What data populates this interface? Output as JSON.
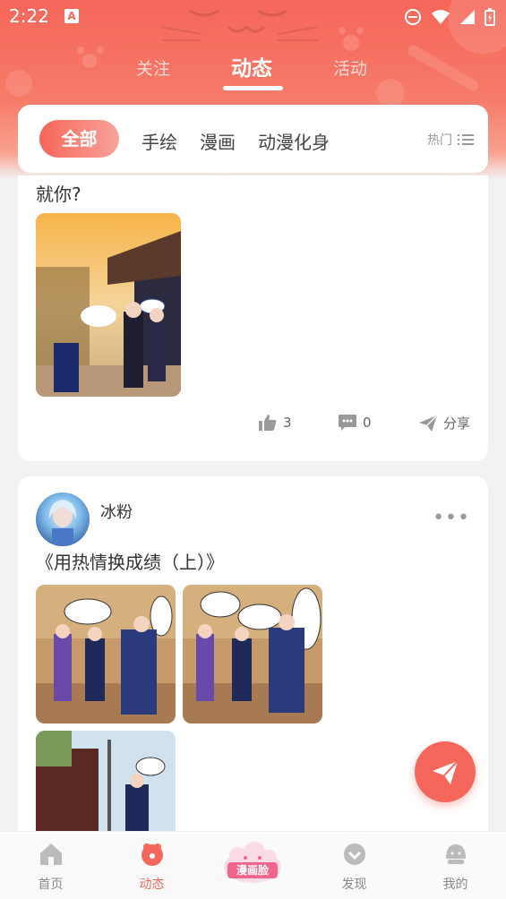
{
  "status_bar": {
    "time": "2:22",
    "notification_letter": "A"
  },
  "top_tabs": [
    {
      "label": "关注"
    },
    {
      "label": "动态"
    },
    {
      "label": "活动"
    }
  ],
  "filters": {
    "active": "全部",
    "items": [
      "手绘",
      "漫画",
      "动漫化身"
    ],
    "sort_label": "热门"
  },
  "post1": {
    "text": "就你?",
    "likes": "3",
    "comments": "0",
    "share_label": "分享"
  },
  "post2": {
    "username": "冰粉",
    "more": "•••",
    "text": "《用热情换成绩（上）》"
  },
  "bottom_nav": [
    {
      "label": "首页"
    },
    {
      "label": "动态"
    },
    {
      "label": "漫画脸"
    },
    {
      "label": "发现"
    },
    {
      "label": "我的"
    }
  ],
  "colors": {
    "accent": "#f5675a",
    "background": "#f2f2f2",
    "badge": "#f2668e"
  }
}
